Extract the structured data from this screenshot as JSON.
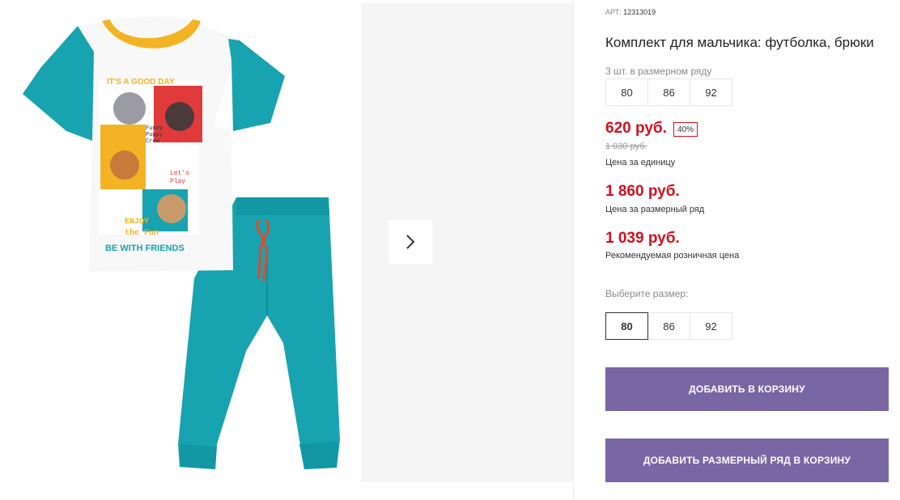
{
  "gallery": {
    "print_text": {
      "line1": "IT'S A GOOD DAY",
      "funny": "Funny",
      "puppy": "Puppy",
      "crew": "Crew",
      "lets": "Let's",
      "play": "Play",
      "enjoy": "ENJOY",
      "the_fun": "the Fun",
      "friends": "BE WITH FRIENDS"
    },
    "next_icon": "chevron-right-icon"
  },
  "product": {
    "sku_label": "АРТ:",
    "sku": "12313019",
    "title": "Комплект для мальчика: футболка, брюки",
    "pack_label": "3 шт. в размерном ряду",
    "pack_sizes": [
      "80",
      "86",
      "92"
    ],
    "price": "620 руб.",
    "discount": "40%",
    "old_price": "1 030 руб.",
    "unit_note": "Цена за единицу",
    "pack_price": "1 860 руб.",
    "pack_note": "Цена за размерный ряд",
    "retail_price": "1 039 руб.",
    "retail_note": "Рекомендуемая розничная цена",
    "choose_label": "Выберите размер:",
    "sizes": [
      "80",
      "86",
      "92"
    ],
    "selected_size": "80",
    "add_to_cart": "ДОБАВИТЬ В КОРЗИНУ",
    "add_pack_to_cart": "ДОБАВИТЬ РАЗМЕРНЫЙ РЯД В КОРЗИНУ"
  },
  "colors": {
    "price_red": "#d0101f",
    "button_purple": "#7a65a5",
    "teal": "#17a3b0",
    "collar_yellow": "#f3b323"
  }
}
